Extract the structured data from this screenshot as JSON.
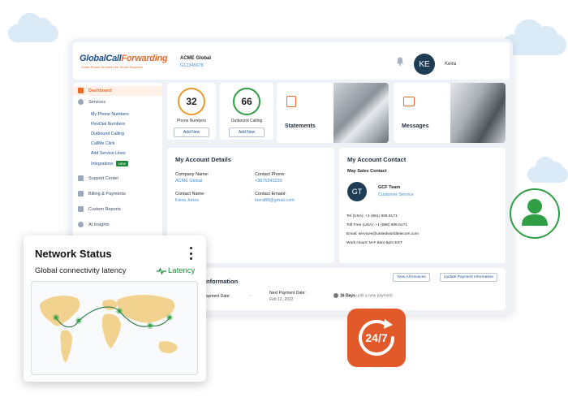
{
  "header": {
    "logo_part1": "GlobalCall",
    "logo_part2": "Forwarding",
    "logo_tagline": "Smart Phone Numbers for Smart Business",
    "account_name": "ACME Global",
    "account_number": "G12345678",
    "user_initials": "KE",
    "user_name": "Keira"
  },
  "sidebar": {
    "items": [
      {
        "label": "Dashboard",
        "icon": "dashboard-icon",
        "active": true
      },
      {
        "label": "Services",
        "icon": "gear-icon"
      },
      {
        "label": "Support Center",
        "icon": "chat-icon"
      },
      {
        "label": "Billing & Payments",
        "icon": "billing-icon"
      },
      {
        "label": "Custom Reports",
        "icon": "report-icon"
      },
      {
        "label": "AI Insights",
        "icon": "sparkle-icon"
      }
    ],
    "services_sub": [
      "My Phone Numbers",
      "FlexDial Numbers",
      "Outbound Calling",
      "CallMe Click",
      "Add Service Lines",
      "Integrations"
    ],
    "new_badge": "NEW"
  },
  "stats": {
    "phone_numbers": {
      "value": "32",
      "label": "Phone Numbers",
      "button": "Add New",
      "color": "#e99a2a"
    },
    "outbound": {
      "value": "66",
      "label": "Outbound Calling",
      "button": "Add New",
      "color": "#2f9e44"
    }
  },
  "tiles": {
    "statements": "Statements",
    "messages": "Messages"
  },
  "account_details": {
    "title": "My Account Details",
    "company_label": "Company Name:",
    "company_value": "ACME Global",
    "phone_label": "Contact Phone:",
    "phone_value": "+9876543235",
    "contact_label": "Contact Name:",
    "contact_value": "Kiera Jones",
    "email_label": "Contact Emaiol:",
    "email_value": "kiera88@gmail.com"
  },
  "account_contact": {
    "title": "My Account Contact",
    "subtitle": "May Sales Contact",
    "initials": "GT",
    "team": "GCF Team",
    "dept": "Customer Service",
    "tel": "Tel (USA): +1 (561) 908 6171",
    "tollfree": "Toll Free (USA): +1 (888) 908 6171",
    "email": "Email: services@unitedworldtelecom.com",
    "hours": "Work Hours: M-F 8am-5pm EST"
  },
  "payment": {
    "title": "nformation",
    "view_invoices": "View All Invoices",
    "update_payment": "Update Payment Information",
    "last_label": "ayment Date:",
    "next_label": "Next Payment Date:",
    "next_value": "Feb 12, 2022",
    "days": "16 Days",
    "days_suffix": "until a new payment"
  },
  "network": {
    "title": "Network Status",
    "subtitle": "Global connectivity latency",
    "latency_label": "Latency"
  },
  "badge_247": "24/7",
  "colors": {
    "brand": "#1d4f8c",
    "accent": "#e96a2a",
    "green": "#2f9e44"
  }
}
